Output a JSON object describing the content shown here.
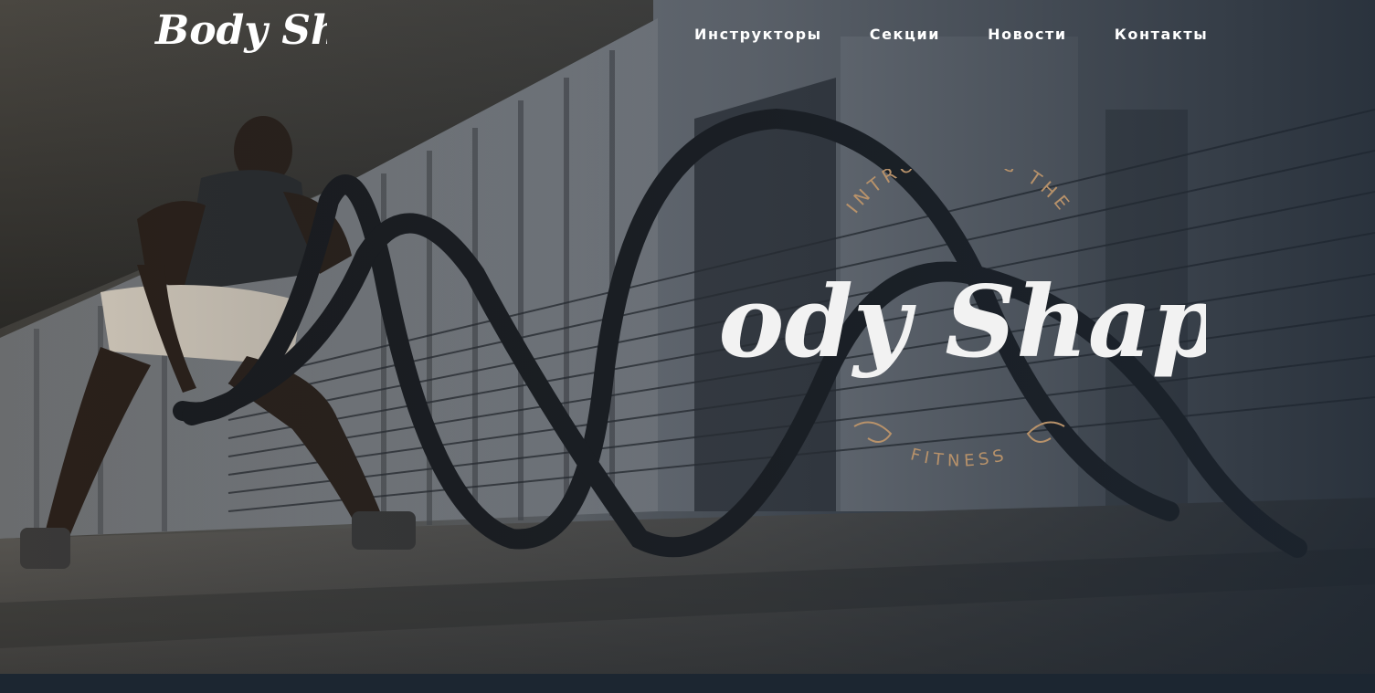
{
  "brand": {
    "logo_text": "Body Shape",
    "hero_logo_text": "Body Shape",
    "hero_arc_top": "INTRODUCING THE",
    "hero_arc_bottom": "FITNESS"
  },
  "nav": {
    "items": [
      {
        "label": "Инструкторы"
      },
      {
        "label": "Секции"
      },
      {
        "label": "Новости"
      },
      {
        "label": "Контакты"
      }
    ]
  },
  "colors": {
    "accent_gold": "#b8926a",
    "text": "#ffffff",
    "footer_strip": "#1c2631"
  }
}
